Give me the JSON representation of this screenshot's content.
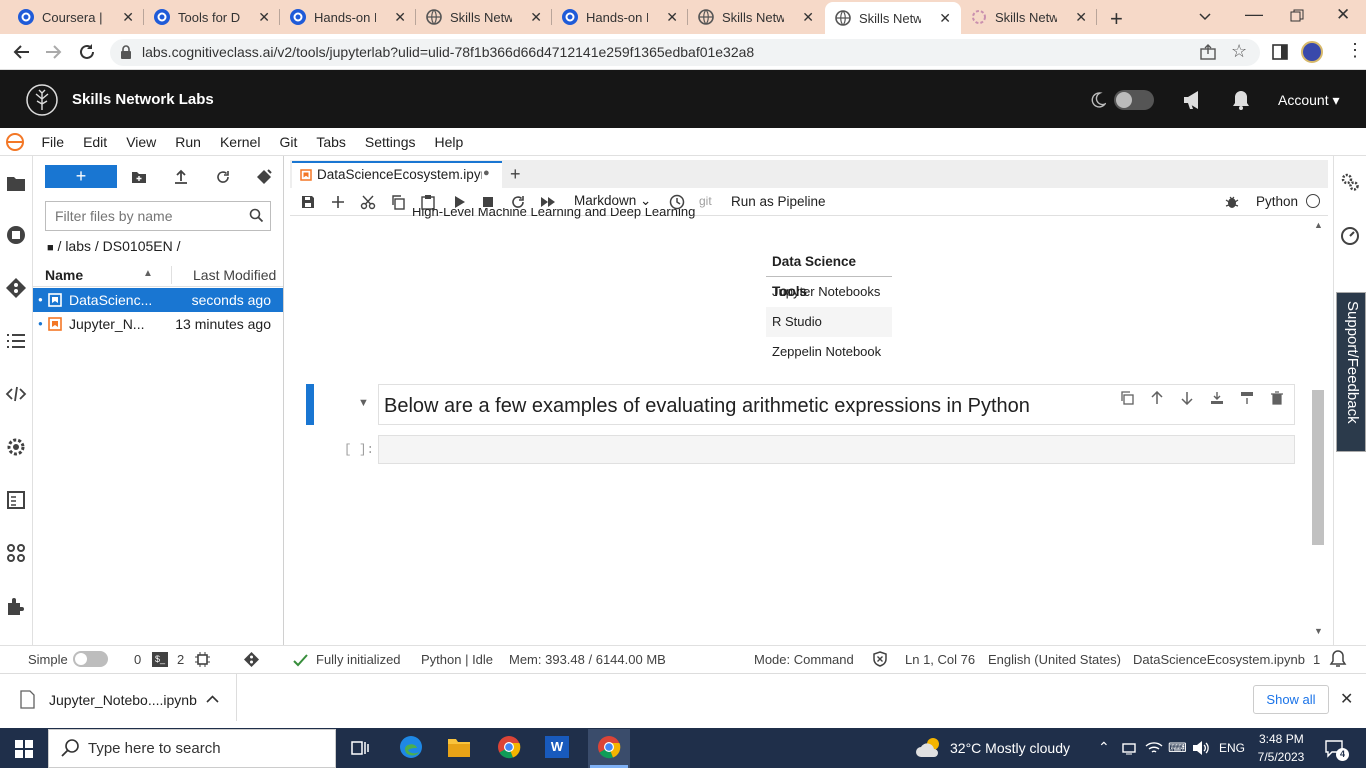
{
  "browser": {
    "tabs": [
      {
        "title": "Coursera | Online Courses",
        "icon": "coursera-icon",
        "active": false
      },
      {
        "title": "Tools for Data Science",
        "icon": "coursera-icon",
        "active": false
      },
      {
        "title": "Hands-on Lab",
        "icon": "coursera-icon",
        "active": false
      },
      {
        "title": "Skills Network Labs",
        "icon": "globe-icon",
        "active": false
      },
      {
        "title": "Hands-on Lab",
        "icon": "coursera-icon",
        "active": false
      },
      {
        "title": "Skills Network Labs",
        "icon": "globe-icon",
        "active": false
      },
      {
        "title": "Skills Network Labs",
        "icon": "globe-icon",
        "active": true
      },
      {
        "title": "Skills Network Labs",
        "icon": "loading-icon",
        "active": false
      }
    ],
    "url": "labs.cognitiveclass.ai/v2/tools/jupyterlab?ulid=ulid-78f1b366d66d4712141e259f1365edbaf01e32a8"
  },
  "header": {
    "title": "Skills Network Labs",
    "account_label": "Account",
    "accent": "#161616"
  },
  "menu": [
    "File",
    "Edit",
    "View",
    "Run",
    "Kernel",
    "Git",
    "Tabs",
    "Settings",
    "Help"
  ],
  "filebrowser": {
    "new_label": "+",
    "filter_placeholder": "Filter files by name",
    "breadcrumb": "/ labs / DS0105EN /",
    "col_name": "Name",
    "col_modified": "Last Modified",
    "files": [
      {
        "name": "DataScienc...",
        "modified": "seconds ago",
        "selected": true
      },
      {
        "name": "Jupyter_N...",
        "modified": "13 minutes ago",
        "selected": false
      }
    ]
  },
  "notebook": {
    "tab_title": "DataScienceEcosystem.ipynb",
    "cell_type": "Markdown",
    "git_label": "git",
    "pipeline_label": "Run as Pipeline",
    "kernel_name": "Python",
    "cut_text": "High-Level Machine Learning and Deep Learning",
    "table_header": "Data Science Tools",
    "table_rows": [
      "Jupyter Notebooks",
      "R Studio",
      "Zeppelin Notebook"
    ],
    "md_heading": "Below are a few examples of evaluating arithmetic expressions in Python",
    "code_prompt": "[ ]:"
  },
  "support_label": "Support/Feedback",
  "status": {
    "mode_label": "Simple",
    "terminals": "0",
    "kernels": "2",
    "init": "Fully initialized",
    "kernel_state": "Python | Idle",
    "memory": "Mem: 393.48 / 6144.00 MB",
    "command_mode": "Mode: Command",
    "cursor": "Ln 1, Col 76",
    "language": "English (United States)",
    "filename": "DataScienceEcosystem.ipynb",
    "notifications": "1"
  },
  "downloads": {
    "file": "Jupyter_Notebo....ipynb",
    "show_all": "Show all"
  },
  "taskbar": {
    "search_placeholder": "Type here to search",
    "weather": "32°C  Mostly cloudy",
    "lang": "ENG",
    "time": "3:48 PM",
    "date": "7/5/2023",
    "notif_count": "4"
  }
}
